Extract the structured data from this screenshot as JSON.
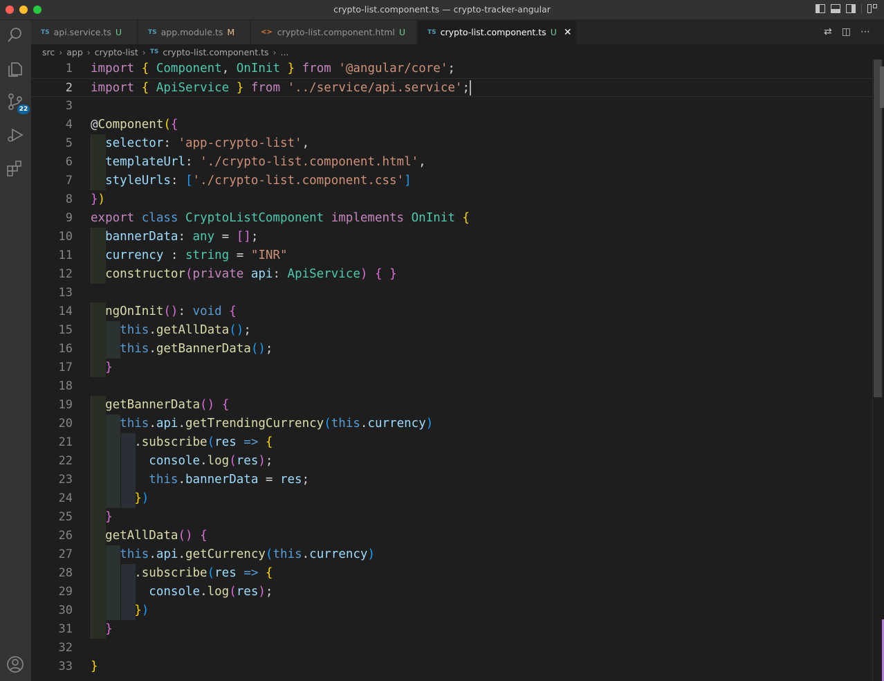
{
  "window": {
    "title": "crypto-list.component.ts — crypto-tracker-angular"
  },
  "activity_bar": {
    "scm_badge": "22"
  },
  "tabs": [
    {
      "icon": "TS",
      "name": "api.service.ts",
      "status": "U",
      "active": false
    },
    {
      "icon": "TS",
      "name": "app.module.ts",
      "status": "M",
      "active": false
    },
    {
      "icon": "<>",
      "name": "crypto-list.component.html",
      "status": "U",
      "active": false
    },
    {
      "icon": "TS",
      "name": "crypto-list.component.ts",
      "status": "U",
      "active": true
    }
  ],
  "breadcrumb": {
    "items": [
      "src",
      "app",
      "crypto-list"
    ],
    "file_icon": "TS",
    "file": "crypto-list.component.ts",
    "trailing": "..."
  },
  "editor": {
    "current_line": 2,
    "line_numbers": [
      "1",
      "2",
      "3",
      "4",
      "5",
      "6",
      "7",
      "8",
      "9",
      "10",
      "11",
      "12",
      "13",
      "14",
      "15",
      "16",
      "17",
      "18",
      "19",
      "20",
      "21",
      "22",
      "23",
      "24",
      "25",
      "26",
      "27",
      "28",
      "29",
      "30",
      "31",
      "32",
      "33"
    ],
    "lines": [
      "import { Component, OnInit } from '@angular/core';",
      "import { ApiService } from '../service/api.service';",
      "",
      "@Component({",
      "  selector: 'app-crypto-list',",
      "  templateUrl: './crypto-list.component.html',",
      "  styleUrls: ['./crypto-list.component.css']",
      "})",
      "export class CryptoListComponent implements OnInit {",
      "  bannerData: any = [];",
      "  currency : string = \"INR\"",
      "  constructor(private api: ApiService) { }",
      "",
      "  ngOnInit(): void {",
      "    this.getAllData();",
      "    this.getBannerData();",
      "  }",
      "",
      "  getBannerData() {",
      "    this.api.getTrendingCurrency(this.currency)",
      "      .subscribe(res => {",
      "        console.log(res);",
      "        this.bannerData = res;",
      "      })",
      "  }",
      "  getAllData() {",
      "    this.api.getCurrency(this.currency)",
      "      .subscribe(res => {",
      "        console.log(res);",
      "      })",
      "  }",
      "",
      "}"
    ]
  },
  "colors": {
    "keyword": "#c586c0",
    "storage": "#569cd6",
    "string": "#ce9178",
    "type": "#4ec9b0",
    "function": "#dcdcaa",
    "variable": "#9cdcfe",
    "editor_bg": "#1e1e1e",
    "activity_bg": "#333333"
  }
}
